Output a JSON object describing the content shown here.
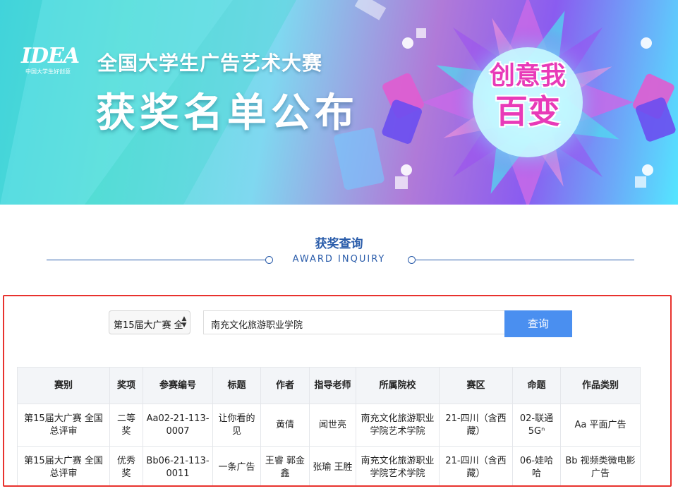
{
  "banner": {
    "logo_text": "IDEA",
    "logo_sub": "中国大学生好创意",
    "title_line1": "全国大学生广告艺术大赛",
    "title_line2": "获奖名单公布",
    "badge_line1": "创意我",
    "badge_line2": "百变"
  },
  "section": {
    "title": "获奖查询",
    "subtitle": "AWARD INQUIRY"
  },
  "query": {
    "select_value": "第15届大广赛 全",
    "search_value": "南充文化旅游职业学院",
    "submit_label": "查询"
  },
  "table": {
    "headers": [
      "赛别",
      "奖项",
      "参赛编号",
      "标题",
      "作者",
      "指导老师",
      "所属院校",
      "赛区",
      "命题",
      "作品类别"
    ],
    "rows": [
      [
        "第15届大广赛 全国总评审",
        "二等奖",
        "Aa02-21-113-0007",
        "让你看的见",
        "黄倩",
        "闻世亮",
        "南充文化旅游职业学院艺术学院",
        "21-四川（含西藏）",
        "02-联通5Gⁿ",
        "Aa 平面广告"
      ],
      [
        "第15届大广赛 全国总评审",
        "优秀奖",
        "Bb06-21-113-0011",
        "一条广告",
        "王睿 郭金鑫",
        "张瑜 王胜",
        "南充文化旅游职业学院艺术学院",
        "21-四川（含西藏）",
        "06-娃哈哈",
        "Bb 视频类微电影广告"
      ]
    ]
  },
  "colors": {
    "accent_blue": "#2a5caa",
    "button_blue": "#4a8ff0",
    "highlight_red": "#e8322e",
    "badge_pink": "#e83ab8"
  }
}
